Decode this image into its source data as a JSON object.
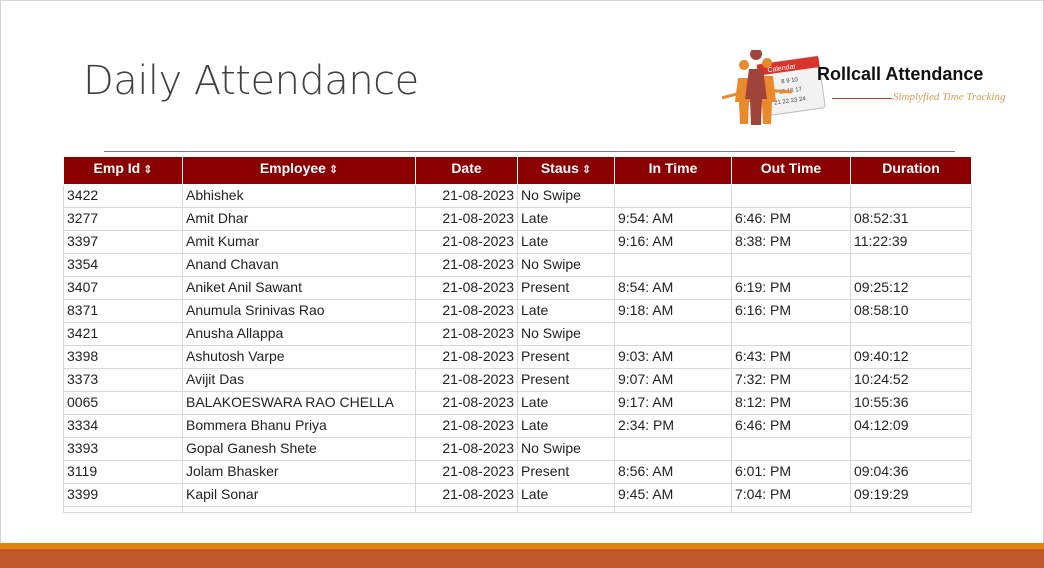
{
  "slide": {
    "title": "Daily Attendance"
  },
  "logo": {
    "title": "Rollcall Attendance",
    "tagline": "Simplyfied Time Tracking",
    "calendar_label": "Calendar",
    "colors": {
      "primary": "#a0433a",
      "accent": "#e88a2c"
    }
  },
  "table": {
    "header_color": "#8b0000",
    "columns": [
      {
        "label": "Emp Id",
        "sortable": true
      },
      {
        "label": "Employee",
        "sortable": true
      },
      {
        "label": "Date",
        "sortable": false
      },
      {
        "label": "Staus",
        "sortable": true
      },
      {
        "label": "In Time",
        "sortable": false
      },
      {
        "label": "Out Time",
        "sortable": false
      },
      {
        "label": "Duration",
        "sortable": false
      }
    ],
    "rows": [
      [
        "3422",
        "Abhishek",
        "21-08-2023",
        "No Swipe",
        "",
        "",
        ""
      ],
      [
        "3277",
        "Amit Dhar",
        "21-08-2023",
        "Late",
        "9:54: AM",
        "6:46: PM",
        "08:52:31"
      ],
      [
        "3397",
        "Amit Kumar",
        "21-08-2023",
        "Late",
        "9:16: AM",
        "8:38: PM",
        "11:22:39"
      ],
      [
        "3354",
        "Anand Chavan",
        "21-08-2023",
        "No Swipe",
        "",
        "",
        ""
      ],
      [
        "3407",
        "Aniket Anil Sawant",
        "21-08-2023",
        "Present",
        "8:54: AM",
        "6:19: PM",
        "09:25:12"
      ],
      [
        "8371",
        "Anumula Srinivas Rao",
        "21-08-2023",
        "Late",
        "9:18: AM",
        "6:16: PM",
        "08:58:10"
      ],
      [
        "3421",
        "Anusha Allappa",
        "21-08-2023",
        "No Swipe",
        "",
        "",
        ""
      ],
      [
        "3398",
        "Ashutosh Varpe",
        "21-08-2023",
        "Present",
        "9:03: AM",
        "6:43: PM",
        "09:40:12"
      ],
      [
        "3373",
        "Avijit Das",
        "21-08-2023",
        "Present",
        "9:07: AM",
        "7:32: PM",
        "10:24:52"
      ],
      [
        "0065",
        "BALAKOESWARA RAO CHELLA",
        "21-08-2023",
        "Late",
        "9:17: AM",
        "8:12: PM",
        "10:55:36"
      ],
      [
        "3334",
        "Bommera Bhanu Priya",
        "21-08-2023",
        "Late",
        "2:34: PM",
        "6:46: PM",
        "04:12:09"
      ],
      [
        "3393",
        "Gopal Ganesh Shete",
        "21-08-2023",
        "No Swipe",
        "",
        "",
        ""
      ],
      [
        "3119",
        "Jolam Bhasker",
        "21-08-2023",
        "Present",
        "8:56: AM",
        "6:01: PM",
        "09:04:36"
      ],
      [
        "3399",
        "Kapil Sonar",
        "21-08-2023",
        "Late",
        "9:45: AM",
        "7:04: PM",
        "09:19:29"
      ]
    ]
  },
  "footer": {
    "colors": {
      "band": "#e2850f",
      "base": "#bf582b"
    }
  }
}
